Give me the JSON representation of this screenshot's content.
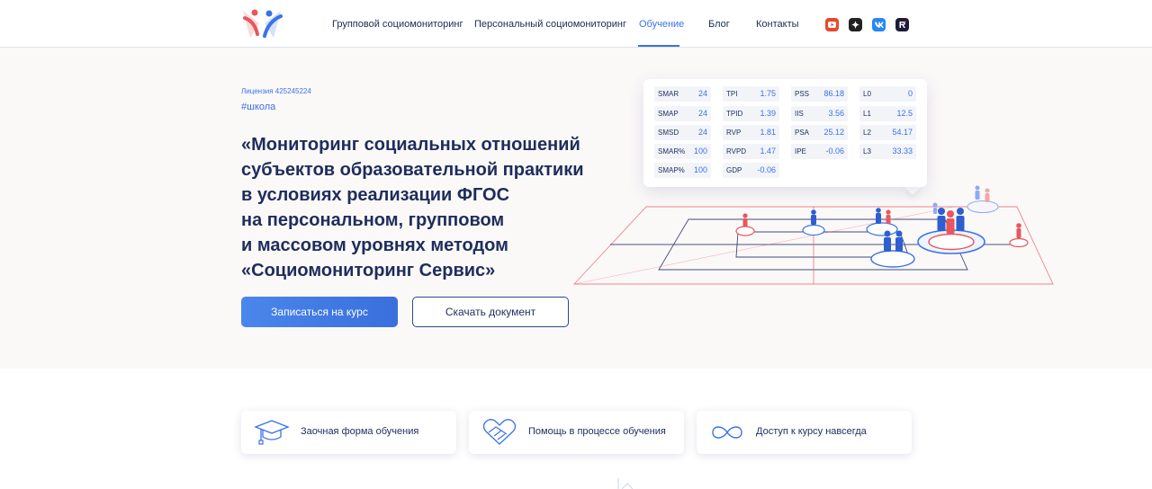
{
  "header": {
    "nav": [
      {
        "label": "Групповой социомониторинг"
      },
      {
        "label": "Персональный социомониторинг"
      },
      {
        "label": "Обучение",
        "active": true
      },
      {
        "label": "Блог"
      },
      {
        "label": "Контакты"
      }
    ],
    "social": [
      {
        "icon": "youtube-icon",
        "color": "#e8472d"
      },
      {
        "icon": "dzen-icon",
        "color": "#222222"
      },
      {
        "icon": "vk-icon",
        "color": "#2787f5"
      },
      {
        "icon": "rutube-icon",
        "color": "#1c1c3a"
      }
    ]
  },
  "hero": {
    "license": "Лицензия 425245224",
    "tag": "#школа",
    "title": "«Мониторинг социальных отношений\nсубъектов образовательной практики\nв условиях реализации ФГОС\nна персональном, групповом\nи массовом уровнях методом\n«Социомониторинг Сервис»",
    "primary_button": "Записаться на курс",
    "secondary_button": "Скачать документ"
  },
  "metrics": {
    "col1": [
      {
        "k": "SMAR",
        "v": "24"
      },
      {
        "k": "SMAP",
        "v": "24"
      },
      {
        "k": "SMSD",
        "v": "24"
      },
      {
        "k": "SMAR%",
        "v": "100"
      },
      {
        "k": "SMAP%",
        "v": "100"
      }
    ],
    "col2": [
      {
        "k": "TPI",
        "v": "1.75"
      },
      {
        "k": "TPID",
        "v": "1.39"
      },
      {
        "k": "RVP",
        "v": "1.81"
      },
      {
        "k": "RVPD",
        "v": "1.47"
      },
      {
        "k": "GDP",
        "v": "-0.06"
      }
    ],
    "col3": [
      {
        "k": "PSS",
        "v": "86.18"
      },
      {
        "k": "IIS",
        "v": "3.56"
      },
      {
        "k": "PSA",
        "v": "25.12"
      },
      {
        "k": "IPE",
        "v": "-0.06"
      }
    ],
    "col4": [
      {
        "k": "L0",
        "v": "0"
      },
      {
        "k": "L1",
        "v": "12.5"
      },
      {
        "k": "L2",
        "v": "54.17"
      },
      {
        "k": "L3",
        "v": "33.33"
      }
    ]
  },
  "features": [
    {
      "label": "Заочная форма обучения",
      "icon": "graduation-cap-icon"
    },
    {
      "label": "Помощь в процессе обучения",
      "icon": "handshake-icon"
    },
    {
      "label": "Доступ к курсу навсегда",
      "icon": "infinity-icon"
    }
  ],
  "colors": {
    "accent": "#3b73e6",
    "title": "#1d2d5c",
    "red": "#e8565e"
  }
}
